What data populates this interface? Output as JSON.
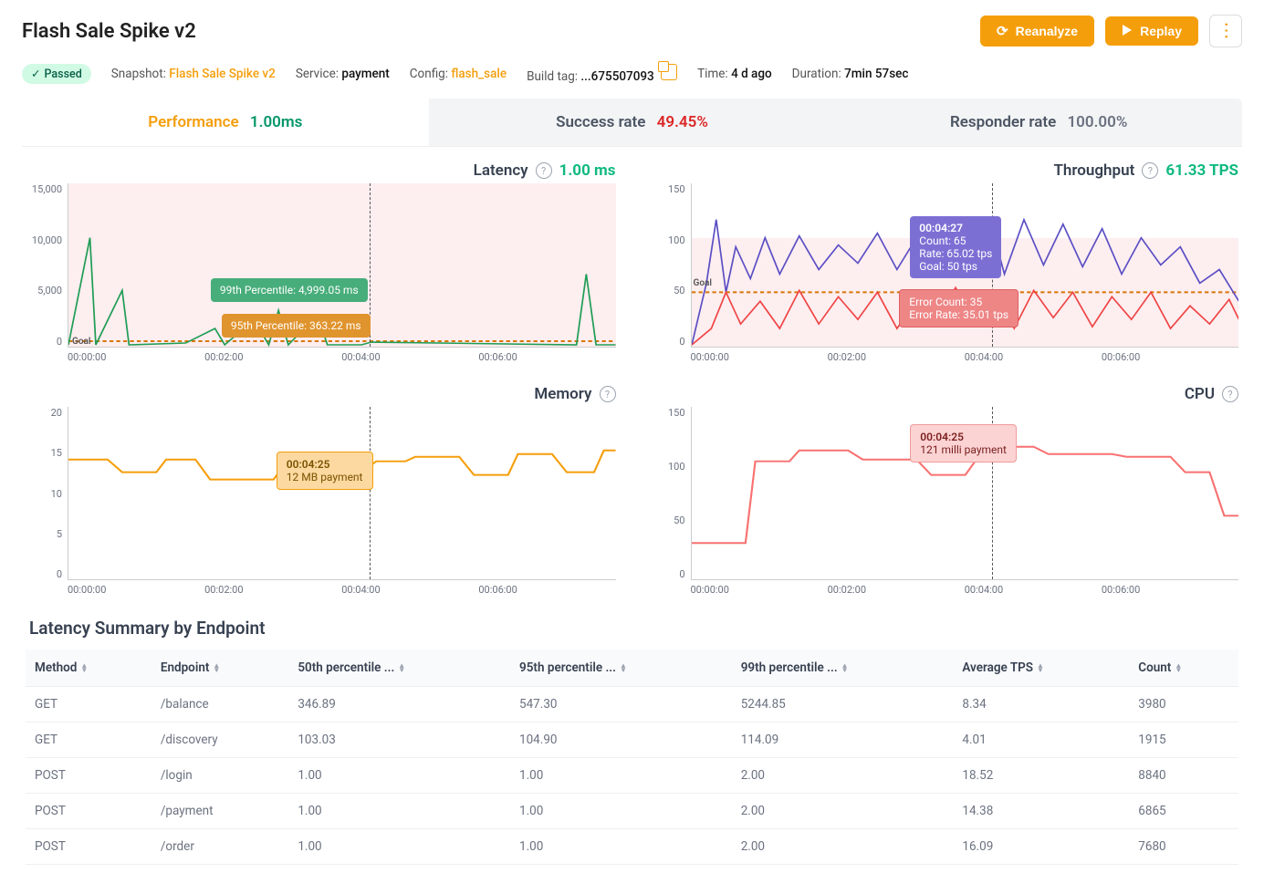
{
  "header": {
    "title": "Flash Sale Spike v2",
    "reanalyze_label": "Reanalyze",
    "replay_label": "Replay"
  },
  "meta": {
    "status_label": "Passed",
    "snapshot_lbl": "Snapshot:",
    "snapshot_val": "Flash Sale Spike v2",
    "service_lbl": "Service:",
    "service_val": "payment",
    "config_lbl": "Config:",
    "config_val": "flash_sale",
    "build_lbl": "Build tag:",
    "build_val": "...675507093",
    "time_lbl": "Time:",
    "time_val": "4 d ago",
    "duration_lbl": "Duration:",
    "duration_val": "7min 57sec"
  },
  "tabs": {
    "perf_label": "Performance",
    "perf_value": "1.00ms",
    "success_label": "Success rate",
    "success_value": "49.45%",
    "responder_label": "Responder rate",
    "responder_value": "100.00%"
  },
  "charts": {
    "latency": {
      "title": "Latency",
      "metric": "1.00 ms",
      "yticks": [
        "15,000",
        "10,000",
        "5,000",
        "0"
      ],
      "tt99": "99th Percentile: 4,999.05 ms",
      "tt95": "95th Percentile: 363.22 ms",
      "goal": "Goal"
    },
    "throughput": {
      "title": "Throughput",
      "metric": "61.33 TPS",
      "yticks": [
        "150",
        "100",
        "50",
        "0"
      ],
      "goal": "Goal",
      "tt1_l1": "00:04:27",
      "tt1_l2": "Count: 65",
      "tt1_l3": "Rate: 65.02 tps",
      "tt1_l4": "Goal: 50 tps",
      "tt2_l1": "Error Count: 35",
      "tt2_l2": "Error Rate: 35.01 tps"
    },
    "memory": {
      "title": "Memory",
      "yticks": [
        "20",
        "15",
        "10",
        "5",
        "0"
      ],
      "tt_l1": "00:04:25",
      "tt_l2": "12 MB payment"
    },
    "cpu": {
      "title": "CPU",
      "yticks": [
        "150",
        "100",
        "50",
        "0"
      ],
      "tt_l1": "00:04:25",
      "tt_l2": "121 milli payment"
    },
    "xticks": [
      "00:00:00",
      "00:02:00",
      "00:04:00",
      "00:06:00"
    ]
  },
  "table": {
    "title": "Latency Summary by Endpoint",
    "headers": [
      "Method",
      "Endpoint",
      "50th percentile ...",
      "95th percentile ...",
      "99th percentile ...",
      "Average TPS",
      "Count"
    ],
    "rows": [
      [
        "GET",
        "/balance",
        "346.89",
        "547.30",
        "5244.85",
        "8.34",
        "3980"
      ],
      [
        "GET",
        "/discovery",
        "103.03",
        "104.90",
        "114.09",
        "4.01",
        "1915"
      ],
      [
        "POST",
        "/login",
        "1.00",
        "1.00",
        "2.00",
        "18.52",
        "8840"
      ],
      [
        "POST",
        "/payment",
        "1.00",
        "1.00",
        "2.00",
        "14.38",
        "6865"
      ],
      [
        "POST",
        "/order",
        "1.00",
        "1.00",
        "2.00",
        "16.09",
        "7680"
      ]
    ]
  },
  "chart_data": [
    {
      "type": "line",
      "title": "Latency",
      "ylabel": "ms",
      "ylim": [
        0,
        15000
      ],
      "xlim": [
        "00:00:00",
        "00:07:57"
      ],
      "series": [
        {
          "name": "99th Percentile",
          "value_at_cursor": 4999.05
        },
        {
          "name": "95th Percentile",
          "value_at_cursor": 363.22
        }
      ],
      "goal": 500,
      "cursor": "00:04:25"
    },
    {
      "type": "line",
      "title": "Throughput",
      "ylabel": "TPS",
      "ylim": [
        0,
        150
      ],
      "xlim": [
        "00:00:00",
        "00:07:57"
      ],
      "series": [
        {
          "name": "Rate",
          "value_at_cursor": 65.02,
          "count": 65
        },
        {
          "name": "Error Rate",
          "value_at_cursor": 35.01,
          "count": 35
        }
      ],
      "goal": 50,
      "cursor": "00:04:27"
    },
    {
      "type": "line",
      "title": "Memory",
      "ylabel": "MB",
      "ylim": [
        0,
        20
      ],
      "xlim": [
        "00:00:00",
        "00:07:57"
      ],
      "series": [
        {
          "name": "payment",
          "value_at_cursor": 12
        }
      ],
      "cursor": "00:04:25"
    },
    {
      "type": "line",
      "title": "CPU",
      "ylabel": "milli",
      "ylim": [
        0,
        150
      ],
      "xlim": [
        "00:00:00",
        "00:07:57"
      ],
      "series": [
        {
          "name": "payment",
          "value_at_cursor": 121
        }
      ],
      "cursor": "00:04:25"
    }
  ]
}
